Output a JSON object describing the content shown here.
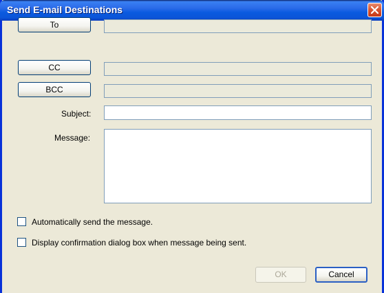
{
  "window": {
    "title": "Send E-mail Destinations"
  },
  "buttons": {
    "to": "To",
    "cc": "CC",
    "bcc": "BCC",
    "ok": "OK",
    "cancel": "Cancel"
  },
  "fields": {
    "to": "",
    "cc": "",
    "bcc": "",
    "subject": "",
    "message": ""
  },
  "labels": {
    "subject": "Subject:",
    "message": "Message:"
  },
  "options": {
    "auto_send": {
      "label": "Automatically send the message.",
      "checked": false
    },
    "confirm_dialog": {
      "label": "Display confirmation dialog box when message being sent.",
      "checked": false
    }
  },
  "state": {
    "ok_enabled": false
  }
}
